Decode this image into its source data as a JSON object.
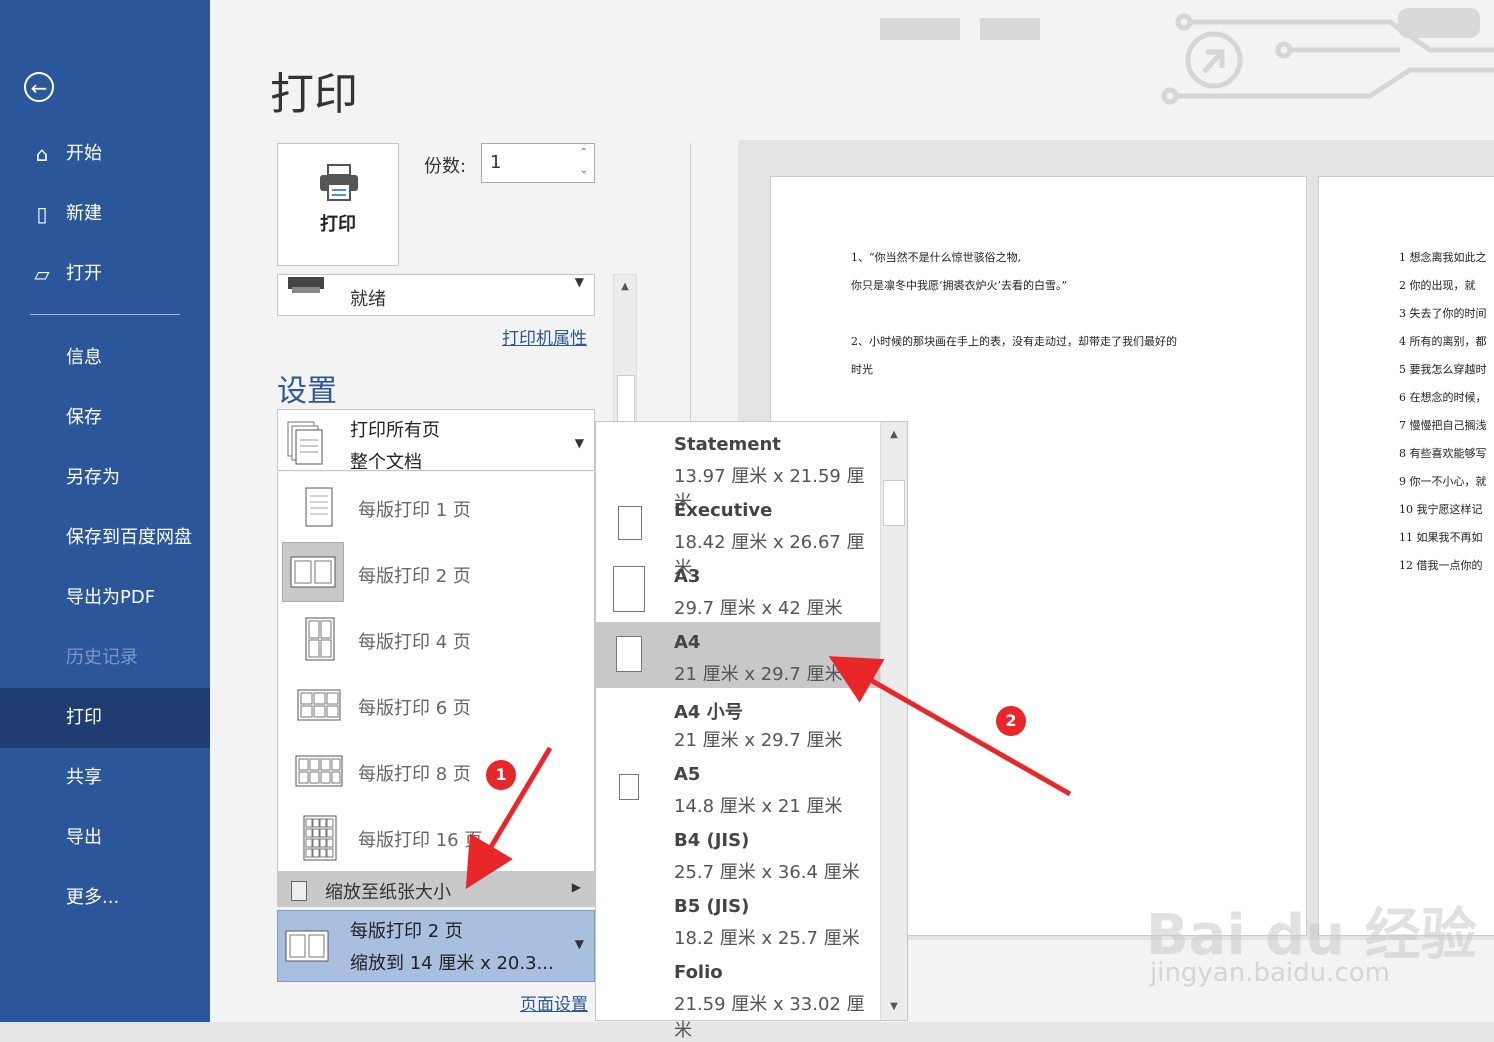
{
  "sidebar": {
    "items": [
      {
        "label": "开始",
        "icon": "home-icon"
      },
      {
        "label": "新建",
        "icon": "new-doc-icon"
      },
      {
        "label": "打开",
        "icon": "open-folder-icon"
      },
      {
        "label": "信息"
      },
      {
        "label": "保存"
      },
      {
        "label": "另存为"
      },
      {
        "label": "保存到百度网盘"
      },
      {
        "label": "导出为PDF"
      },
      {
        "label": "历史记录"
      },
      {
        "label": "打印"
      },
      {
        "label": "共享"
      },
      {
        "label": "导出"
      },
      {
        "label": "更多..."
      }
    ]
  },
  "page": {
    "title": "打印"
  },
  "print": {
    "button_label": "打印",
    "copies_label": "份数:",
    "copies_value": "1"
  },
  "printer": {
    "status": "就绪",
    "properties_link": "打印机属性"
  },
  "settings": {
    "heading": "设置",
    "range_line1": "打印所有页",
    "range_line2": "整个文档",
    "pages_per_sheet": [
      "每版打印 1 页",
      "每版打印 2 页",
      "每版打印 4 页",
      "每版打印 6 页",
      "每版打印 8 页",
      "每版打印 16 页"
    ],
    "scale_to_paper": "缩放至纸张大小",
    "current_line1": "每版打印 2 页",
    "current_line2": "缩放到 14 厘米 x 20.3...",
    "page_setup_link": "页面设置"
  },
  "paper_sizes": [
    {
      "name": "Statement",
      "size": "13.97 厘米 x 21.59 厘米"
    },
    {
      "name": "Executive",
      "size": "18.42 厘米 x 26.67 厘米"
    },
    {
      "name": "A3",
      "size": "29.7 厘米 x 42 厘米"
    },
    {
      "name": "A4",
      "size": "21 厘米 x 29.7 厘米"
    },
    {
      "name": "A4 小号",
      "size": "21 厘米 x 29.7 厘米"
    },
    {
      "name": "A5",
      "size": "14.8 厘米 x 21 厘米"
    },
    {
      "name": "B4 (JIS)",
      "size": "25.7 厘米 x 36.4 厘米"
    },
    {
      "name": "B5 (JIS)",
      "size": "18.2 厘米 x 25.7 厘米"
    },
    {
      "name": "Folio",
      "size": "21.59 厘米 x 33.02 厘米"
    }
  ],
  "preview": {
    "page1_lines": [
      "1、“你当然不是什么惊世骇俗之物,",
      "你只是凛冬中我愿‘拥裘衣炉火’去看的白雪。”",
      "2、小时候的那块画在手上的表，没有走动过，却带走了我们最好的",
      "时光"
    ],
    "page2_lines": [
      "1 想念离我如此之",
      "2 你的出现，就",
      "3 失去了你的时间",
      "4 所有的离别，都",
      "5 要我怎么穿越时",
      "6 在想念的时候，",
      "7 慢慢把自己搁浅",
      "8 有些喜欢能够写",
      "9 你一不小心，就",
      "10 我宁愿这样记",
      "11 如果我不再如",
      "12 借我一点你的"
    ]
  },
  "annotations": {
    "badge1": "1",
    "badge2": "2",
    "color": "#e8272a"
  },
  "watermark": {
    "text": "Bai du 经验",
    "sub": "jingyan.baidu.com"
  }
}
